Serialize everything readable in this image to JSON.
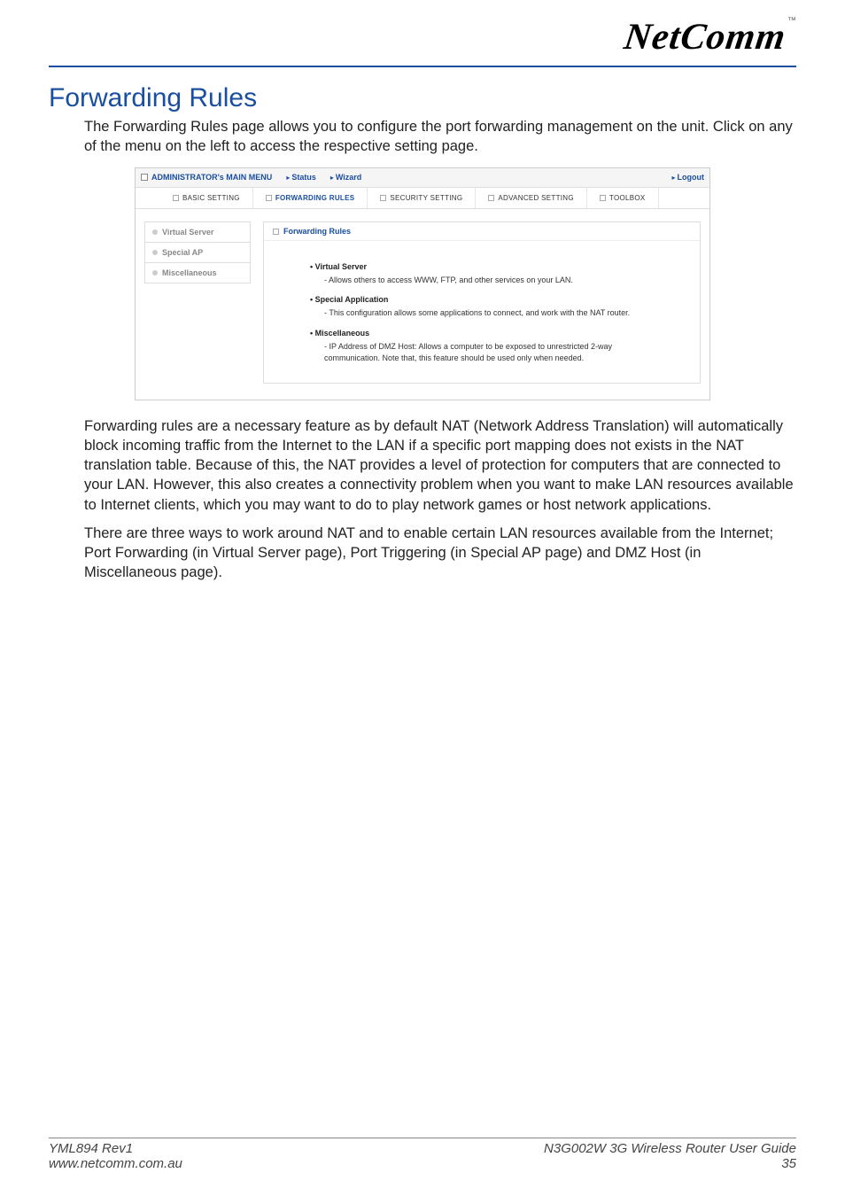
{
  "logo": {
    "text": "NetComm",
    "tm": "™"
  },
  "heading": "Forwarding Rules",
  "intro": "The Forwarding Rules page allows you to configure the port forwarding management on the unit. Click on any of the menu on the left to access the respective setting page.",
  "screenshot": {
    "topbar": {
      "admin": "ADMINISTRATOR's MAIN MENU",
      "status": "Status",
      "wizard": "Wizard",
      "logout": "Logout"
    },
    "tabs": {
      "basic": "BASIC SETTING",
      "forwarding": "FORWARDING RULES",
      "security": "SECURITY SETTING",
      "advanced": "ADVANCED SETTING",
      "toolbox": "TOOLBOX"
    },
    "sidebar": {
      "virtual_server": "Virtual Server",
      "special_ap": "Special AP",
      "misc": "Miscellaneous"
    },
    "panel": {
      "title": "Forwarding Rules",
      "items": {
        "vs_title": "Virtual Server",
        "vs_desc": "- Allows others to access WWW, FTP, and other services on your LAN.",
        "sa_title": "Special Application",
        "sa_desc": "- This configuration allows some applications to connect, and work with the NAT router.",
        "mi_title": "Miscellaneous",
        "mi_desc": "- IP Address of DMZ Host: Allows a computer to be exposed to unrestricted 2-way communication. Note that, this feature should be used only when needed."
      }
    }
  },
  "para2": "Forwarding rules are a necessary feature as by default NAT (Network Address Translation) will automatically block incoming traffic from the Internet to the LAN if a specific port mapping does not exists in the NAT translation table. Because of this, the NAT provides a level of protection for computers that are connected to your LAN. However, this also creates a connectivity problem when you want to make LAN resources available to Internet clients, which you may want to do to play network games or host network applications.",
  "para3": "There are three ways to work around NAT and to enable certain LAN resources available from the Internet; Port Forwarding (in Virtual Server page), Port Triggering (in Special AP page) and DMZ Host (in Miscellaneous page).",
  "footer": {
    "rev": "YML894 Rev1",
    "url": "www.netcomm.com.au",
    "guide": "N3G002W 3G Wireless Router User Guide",
    "page": "35"
  }
}
